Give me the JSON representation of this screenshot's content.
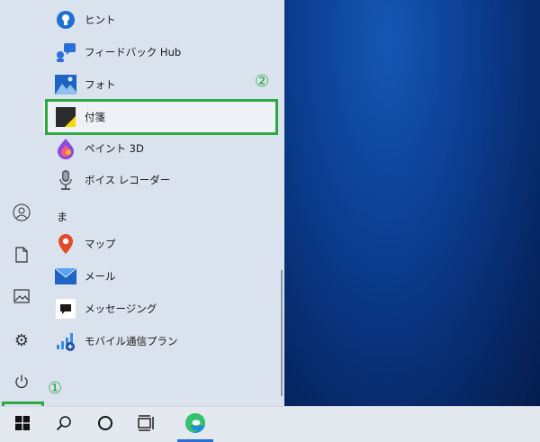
{
  "start_menu": {
    "apps": [
      {
        "label": "ヒント",
        "icon": "tips-icon"
      },
      {
        "label": "フィードバック Hub",
        "icon": "feedback-hub-icon"
      },
      {
        "label": "フォト",
        "icon": "photos-icon"
      },
      {
        "label": "付箋",
        "icon": "sticky-notes-icon",
        "selected": true
      },
      {
        "label": "ペイント 3D",
        "icon": "paint-3d-icon"
      },
      {
        "label": "ボイス レコーダー",
        "icon": "voice-recorder-icon"
      },
      {
        "label": "マップ",
        "icon": "maps-icon"
      },
      {
        "label": "メール",
        "icon": "mail-icon"
      },
      {
        "label": "メッセージング",
        "icon": "messaging-icon"
      },
      {
        "label": "モバイル通信プラン",
        "icon": "mobile-plans-icon"
      }
    ],
    "group_letter": "ま",
    "rail_icons": [
      "user-icon",
      "documents-icon",
      "pictures-icon",
      "settings-icon",
      "power-icon"
    ]
  },
  "annotations": {
    "step1": "①",
    "step2": "②",
    "color": "#2ea843"
  },
  "taskbar": {
    "icons": [
      "windows-start-icon",
      "search-icon",
      "cortana-icon",
      "task-view-icon",
      "edge-icon"
    ],
    "accent": "#2a6fd6"
  }
}
